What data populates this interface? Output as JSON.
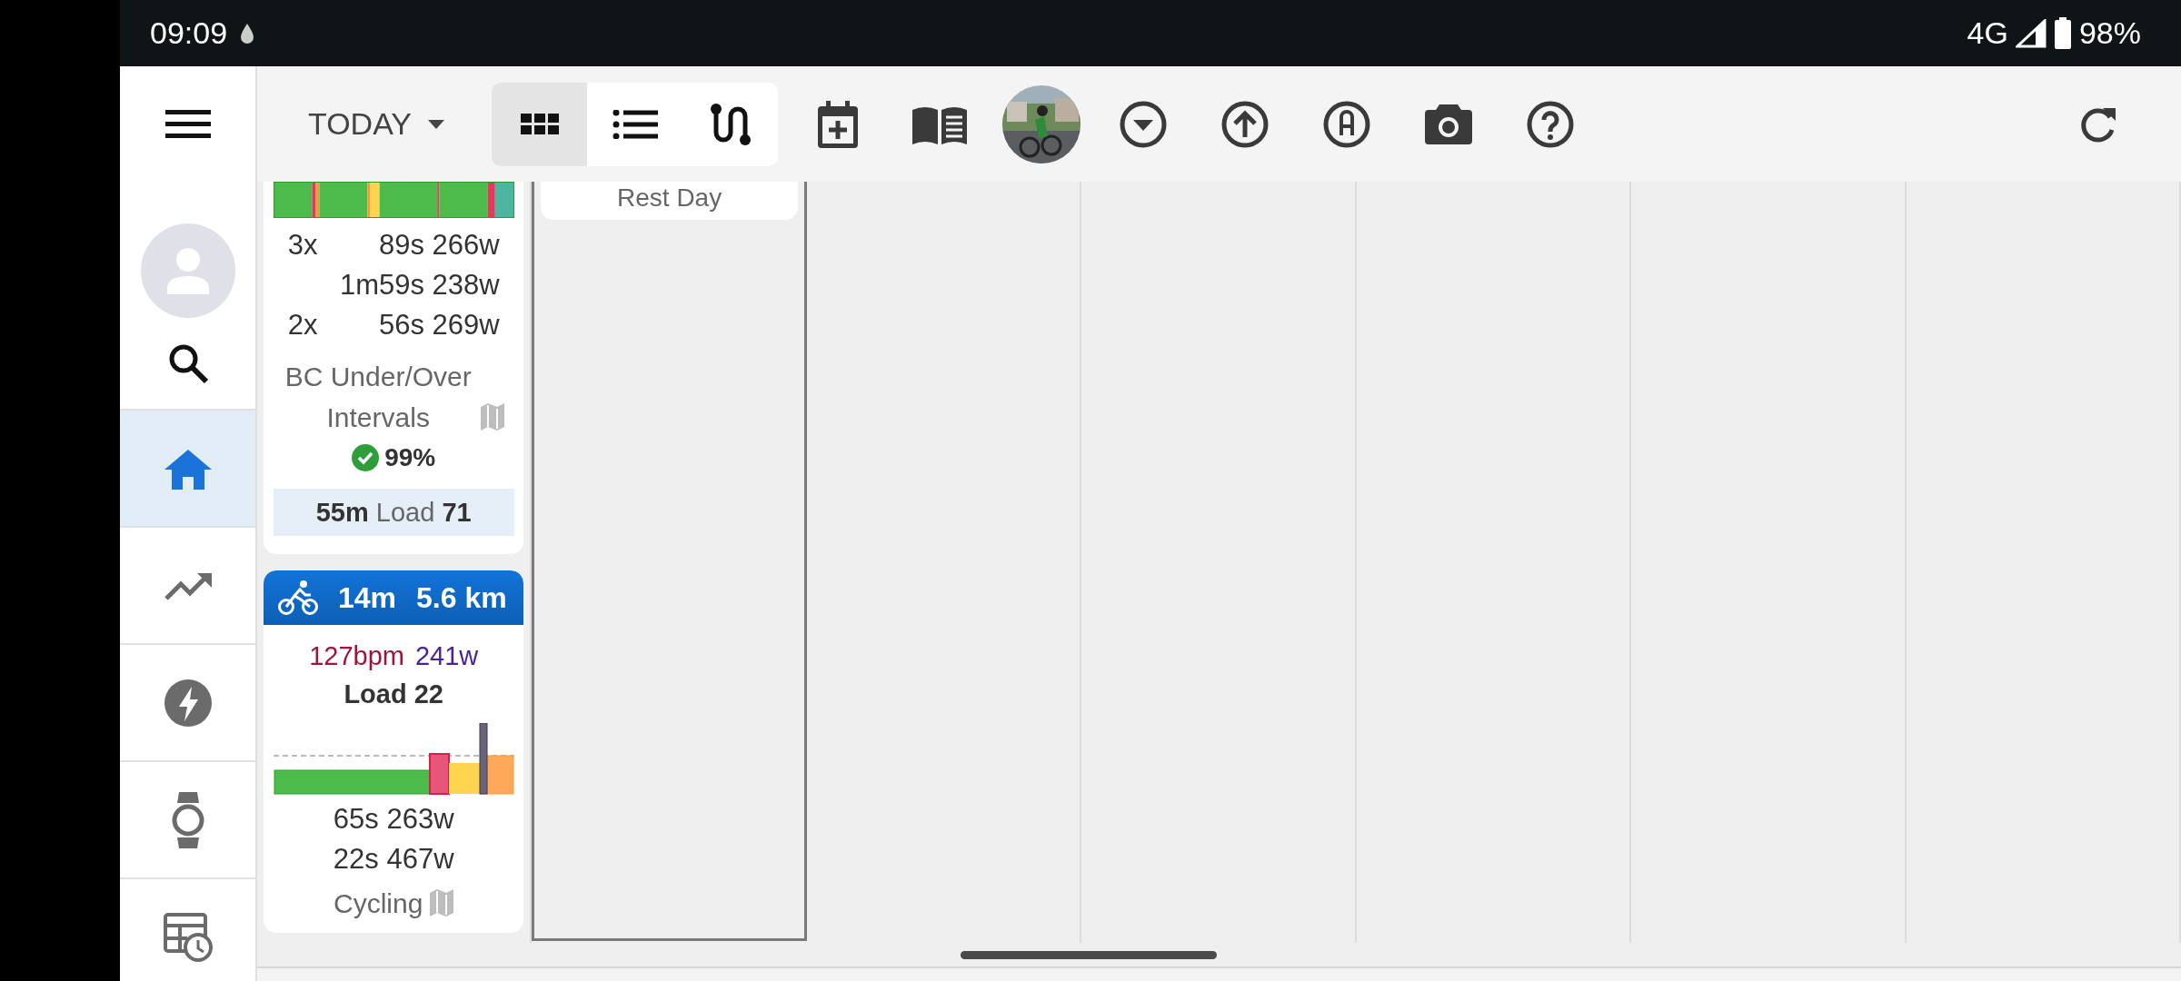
{
  "status_bar": {
    "time": "09:09",
    "network": "4G",
    "battery": "98%"
  },
  "toolbar": {
    "date_button": "TODAY",
    "view_toggle": [
      {
        "kind": "grid",
        "selected": true
      },
      {
        "kind": "list",
        "selected": false
      },
      {
        "kind": "route",
        "selected": false
      }
    ]
  },
  "sidebar": {
    "items": [
      {
        "kind": "avatar",
        "selected": false
      },
      {
        "kind": "search",
        "selected": false
      },
      {
        "kind": "home",
        "selected": true
      },
      {
        "kind": "trend",
        "selected": false
      },
      {
        "kind": "power",
        "selected": false
      },
      {
        "kind": "watch",
        "selected": false
      },
      {
        "kind": "schedule",
        "selected": false
      }
    ]
  },
  "calendar": {
    "columns": [
      {
        "selected": false,
        "cards": [
          {
            "kind": "workout",
            "intervals": [
              {
                "count": "3x",
                "duration": "89s",
                "power": "266w"
              },
              {
                "duration": "1m59s",
                "power": "238w"
              },
              {
                "count": "2x",
                "duration": "56s",
                "power": "269w"
              }
            ],
            "title": "BC Under/Over Intervals",
            "compliance": "99%",
            "footer": {
              "duration": "55m",
              "label": "Load",
              "load": "71"
            }
          },
          {
            "kind": "activity",
            "header": {
              "duration": "14m",
              "distance": "5.6 km"
            },
            "heart_rate": "127bpm",
            "power": "241w",
            "load": "Load 22",
            "efforts": [
              {
                "duration": "65s",
                "power": "263w"
              },
              {
                "duration": "22s",
                "power": "467w"
              }
            ],
            "title": "Cycling"
          }
        ]
      },
      {
        "selected": true,
        "cards": [
          {
            "kind": "rest",
            "title": "Rest Day"
          }
        ]
      },
      {
        "selected": false
      },
      {
        "selected": false
      },
      {
        "selected": false
      },
      {
        "selected": false
      },
      {
        "selected": false
      }
    ]
  }
}
